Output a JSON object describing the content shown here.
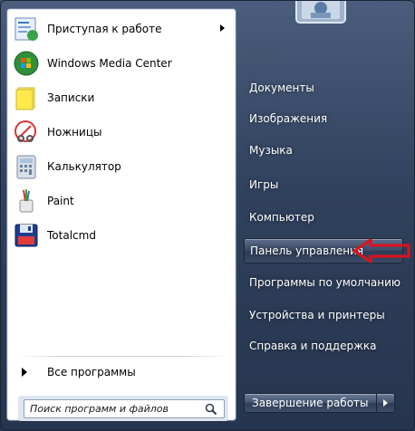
{
  "left_pane": {
    "apps": [
      {
        "label": "Приступая к работе",
        "icon": "getting-started-icon",
        "has_submenu": true
      },
      {
        "label": "Windows Media Center",
        "icon": "windows-media-center-icon",
        "has_submenu": false
      },
      {
        "label": "Записки",
        "icon": "sticky-notes-icon",
        "has_submenu": false
      },
      {
        "label": "Ножницы",
        "icon": "snipping-tool-icon",
        "has_submenu": false
      },
      {
        "label": "Калькулятор",
        "icon": "calculator-icon",
        "has_submenu": false
      },
      {
        "label": "Paint",
        "icon": "paint-icon",
        "has_submenu": false
      },
      {
        "label": "Totalcmd",
        "icon": "total-commander-icon",
        "has_submenu": false
      }
    ],
    "all_programs_label": "Все программы",
    "search": {
      "placeholder": "Поиск программ и файлов",
      "value": ""
    }
  },
  "right_pane": {
    "items": [
      {
        "label": "Документы"
      },
      {
        "label": "Изображения"
      },
      {
        "label": "Музыка"
      },
      {
        "label": "Игры"
      },
      {
        "label": "Компьютер"
      },
      {
        "label": "Панель управления",
        "active": true
      },
      {
        "label": "Программы по умолчанию"
      },
      {
        "label": "Устройства и принтеры"
      },
      {
        "label": "Справка и поддержка"
      }
    ]
  },
  "shutdown": {
    "label": "Завершение работы"
  },
  "colors": {
    "highlight_arrow": "#e0101a",
    "pane_text": "#ffffff"
  }
}
